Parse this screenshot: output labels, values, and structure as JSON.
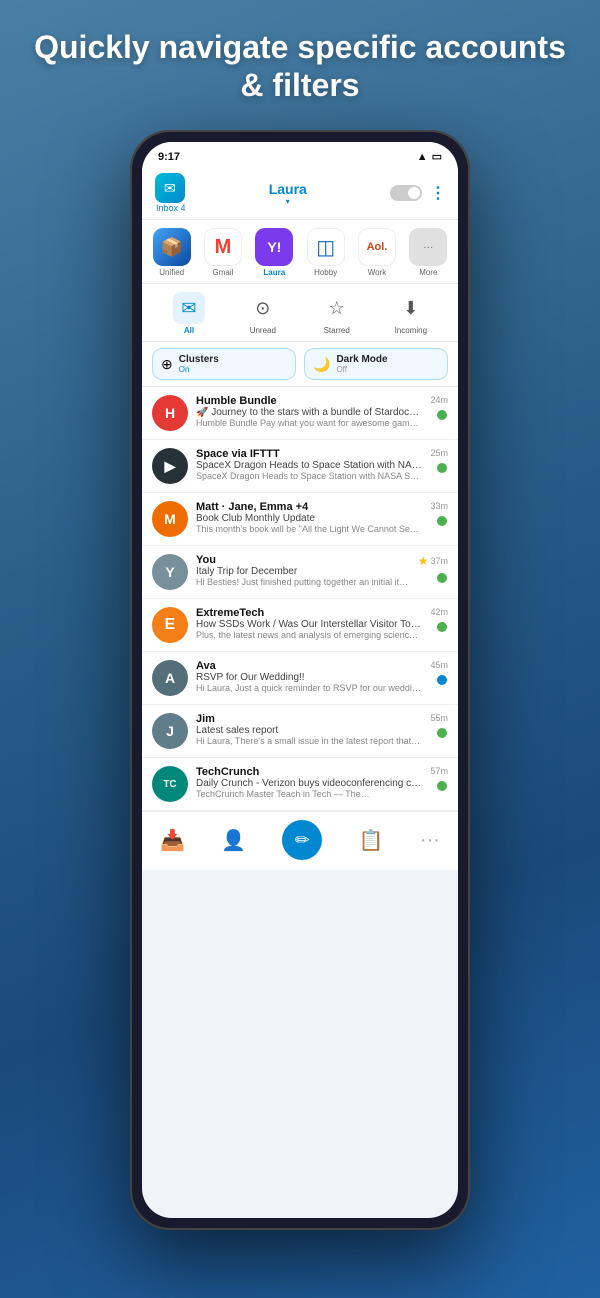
{
  "hero": {
    "title": "Quickly navigate specific accounts & filters"
  },
  "status_bar": {
    "time": "9:17",
    "wifi": "📶",
    "battery": "🔋"
  },
  "top_nav": {
    "inbox_label": "Inbox 4",
    "account_name": "Laura",
    "chevron": "▾"
  },
  "account_tabs": [
    {
      "id": "unified",
      "label": "Unified",
      "icon": "📦",
      "style": "unified"
    },
    {
      "id": "gmail",
      "label": "Gmail",
      "icon": "M",
      "style": "gmail"
    },
    {
      "id": "laura",
      "label": "Laura",
      "icon": "Y!",
      "style": "laura",
      "active": true
    },
    {
      "id": "hobby",
      "label": "Hobby",
      "icon": "◫",
      "style": "hobby"
    },
    {
      "id": "work",
      "label": "Work",
      "icon": "Aol.",
      "style": "work"
    },
    {
      "id": "more",
      "label": "More",
      "icon": "···",
      "style": "more"
    }
  ],
  "filters": [
    {
      "id": "all",
      "label": "All",
      "icon": "✉",
      "active": true
    },
    {
      "id": "unread",
      "label": "Unread",
      "icon": "⊙"
    },
    {
      "id": "starred",
      "label": "Starred",
      "icon": "☆"
    },
    {
      "id": "incoming",
      "label": "Incoming",
      "icon": "⬇"
    }
  ],
  "features": [
    {
      "id": "clusters",
      "icon": "⊕",
      "title": "Clusters",
      "sub": "On"
    },
    {
      "id": "darkmode",
      "icon": "🌙",
      "title": "Dark Mode",
      "sub": "Off"
    }
  ],
  "emails": [
    {
      "id": "humble-bundle",
      "sender": "Humble Bundle",
      "subject": "🚀 Journey to the stars with a bundle of Stardock strategy …",
      "preview": "Humble Bundle Pay what you want for awesome games a…",
      "time": "24m",
      "avatar_bg": "#e53935",
      "avatar_text": "H",
      "unread": true,
      "unread_color": "green"
    },
    {
      "id": "space-ifttt",
      "sender": "Space via IFTTT",
      "subject": "SpaceX Dragon Heads to Space Station with NASA Scienc…",
      "preview": "SpaceX Dragon Heads to Space Station with NASA Scienc…",
      "time": "25m",
      "avatar_bg": "#263238",
      "avatar_text": "▶",
      "unread": true,
      "unread_color": "green"
    },
    {
      "id": "matt-group",
      "sender": "Matt · Jane, Emma +4",
      "subject": "Book Club Monthly Update",
      "preview": "This month's book will be \"All the Light We Cannot See\" by …",
      "time": "33m",
      "avatar_bg": "#ff7043",
      "avatar_text": "M",
      "unread": true,
      "unread_color": "green",
      "multi": true
    },
    {
      "id": "you",
      "sender": "You",
      "subject": "Italy Trip for December",
      "preview": "Hi Besties! Just finished putting together an initial itinerary…",
      "time": "37m",
      "avatar_bg": "#78909c",
      "avatar_text": "Y",
      "starred": true,
      "unread": true,
      "unread_color": "green"
    },
    {
      "id": "extremetech",
      "sender": "ExtremeTech",
      "subject": "How SSDs Work / Was Our Interstellar Visitor Torn Apart b…",
      "preview": "Plus, the latest news and analysis of emerging science an…",
      "time": "42m",
      "avatar_bg": "#f57f17",
      "avatar_text": "E",
      "unread": true,
      "unread_color": "green"
    },
    {
      "id": "ava",
      "sender": "Ava",
      "subject": "RSVP for Our Wedding!!",
      "preview": "Hi Laura, Just a quick reminder to RSVP for our wedding. I'll nee…",
      "time": "45m",
      "avatar_bg": "#546e7a",
      "avatar_text": "A",
      "unread": true,
      "unread_color": "blue"
    },
    {
      "id": "jim",
      "sender": "Jim",
      "subject": "Latest sales report",
      "preview": "Hi Laura, There's a small issue in the latest report that was…",
      "time": "55m",
      "avatar_bg": "#78909c",
      "avatar_text": "J",
      "unread": true,
      "unread_color": "green"
    },
    {
      "id": "techcrunch",
      "sender": "TechCrunch",
      "subject": "Daily Crunch - Verizon buys videoconferencing company B…",
      "preview": "TechCrunch Master Teach in Tech — The…",
      "time": "57m",
      "avatar_bg": "#00897b",
      "avatar_text": "TC",
      "unread": true,
      "unread_color": "green"
    }
  ],
  "bottom_nav": [
    {
      "id": "inbox",
      "icon": "📥",
      "active": true
    },
    {
      "id": "contacts",
      "icon": "👤",
      "active": false
    },
    {
      "id": "compose",
      "icon": "✏",
      "active": false,
      "compose": true
    },
    {
      "id": "tasks",
      "icon": "📋",
      "active": false
    },
    {
      "id": "more",
      "icon": "···",
      "active": false
    }
  ]
}
